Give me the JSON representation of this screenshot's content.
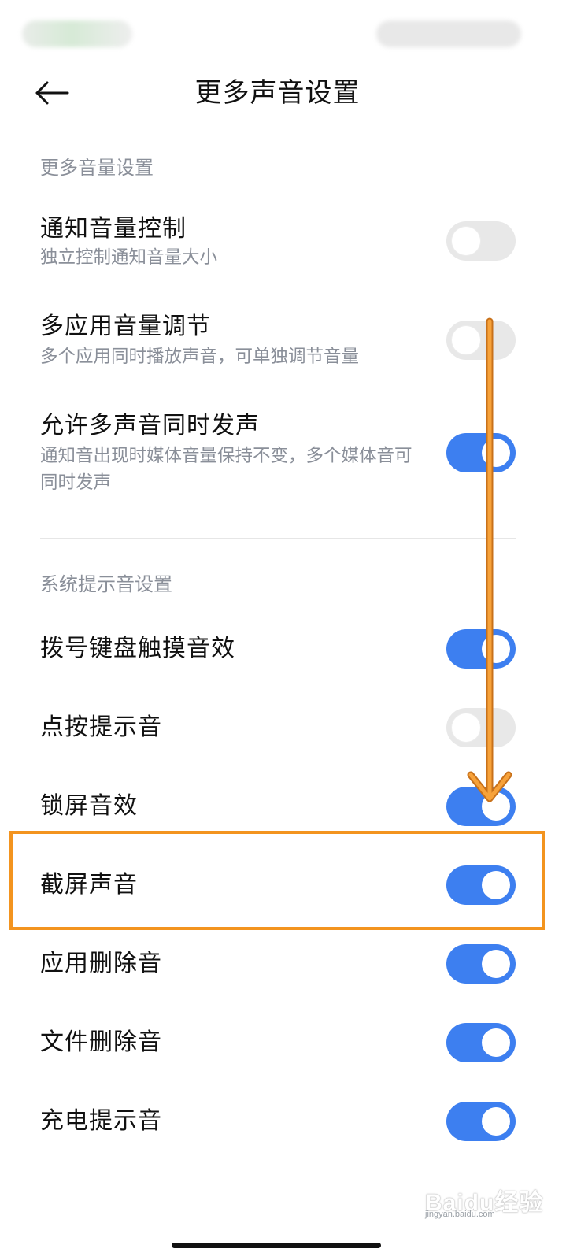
{
  "header": {
    "title": "更多声音设置",
    "back_icon": "arrow-left-icon"
  },
  "sections": [
    {
      "header": "更多音量设置",
      "items": [
        {
          "title": "通知音量控制",
          "description": "独立控制通知音量大小",
          "enabled": false
        },
        {
          "title": "多应用音量调节",
          "description": "多个应用同时播放声音，可单独调节音量",
          "enabled": false
        },
        {
          "title": "允许多声音同时发声",
          "description": "通知音出现时媒体音量保持不变，多个媒体音可同时发声",
          "enabled": true
        }
      ]
    },
    {
      "header": "系统提示音设置",
      "items": [
        {
          "title": "拨号键盘触摸音效",
          "enabled": true
        },
        {
          "title": "点按提示音",
          "enabled": false
        },
        {
          "title": "锁屏音效",
          "enabled": true
        },
        {
          "title": "截屏声音",
          "enabled": true
        },
        {
          "title": "应用删除音",
          "enabled": true
        },
        {
          "title": "文件删除音",
          "enabled": true
        },
        {
          "title": "充电提示音",
          "enabled": true
        }
      ]
    }
  ],
  "annotation": {
    "highlighted_item": "截屏声音",
    "color": "#f3941f"
  },
  "colors": {
    "toggle_on": "#3d7ff0",
    "toggle_off": "#e8e8e8",
    "secondary_text": "#8a8f99"
  },
  "watermark": {
    "logo": "Baidu经验",
    "url": "jingyan.baidu.com"
  }
}
